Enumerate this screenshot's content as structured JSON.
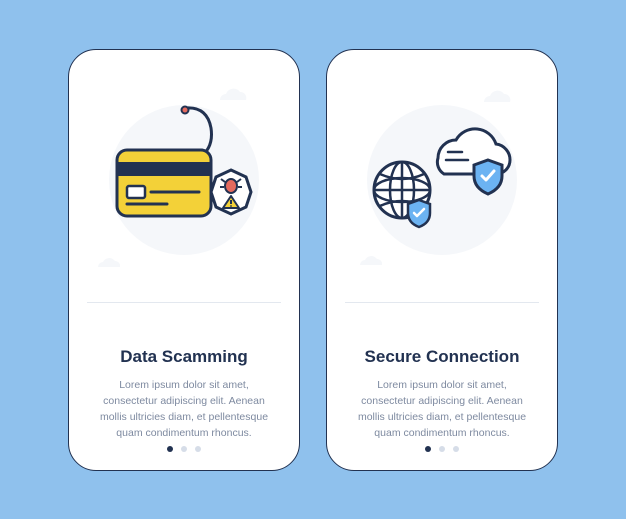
{
  "cards": [
    {
      "title": "Data Scamming",
      "body": "Lorem ipsum dolor sit amet, consectetur adipiscing elit. Aenean mollis ultricies diam, et pellentesque quam condimentum rhoncus."
    },
    {
      "title": "Secure Connection",
      "body": "Lorem ipsum dolor sit amet, consectetur adipiscing elit. Aenean mollis ultricies diam, et pellentesque quam condimentum rhoncus."
    }
  ],
  "pager": {
    "count": 3,
    "activeIndex": 0
  },
  "colors": {
    "background": "#8fc1ed",
    "stroke": "#223251",
    "cardYellow": "#f3d138",
    "accentBlue": "#6cb3f2",
    "warnRed": "#e46a5e",
    "mutedText": "#7e8aa0",
    "softGray": "#f5f7fa"
  }
}
